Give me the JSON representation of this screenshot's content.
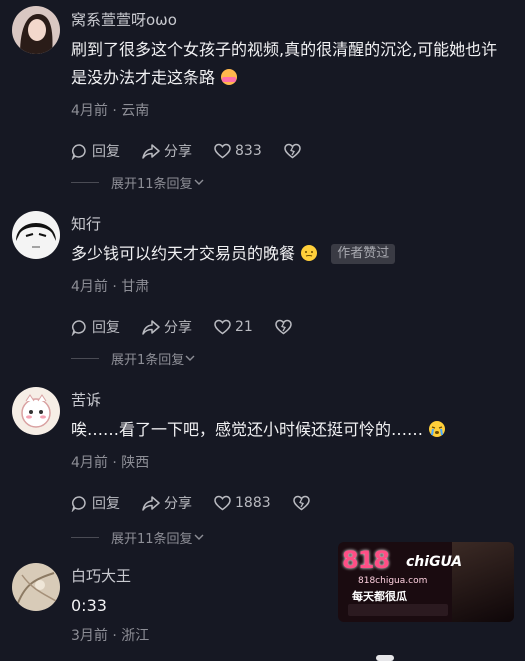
{
  "comments": [
    {
      "username": "窝系萱萱呀oωo",
      "text": "刷到了很多这个女孩子的视频,真的很清醒的沉沦,可能她也许是没办法才走这条路",
      "time": "4月前",
      "location": "云南",
      "reply_label": "回复",
      "share_label": "分享",
      "likes": "833",
      "expand_text": "展开11条回复"
    },
    {
      "username": "知行",
      "text": "多少钱可以约天才交易员的晚餐",
      "badge": "作者赞过",
      "time": "4月前",
      "location": "甘肃",
      "reply_label": "回复",
      "share_label": "分享",
      "likes": "21",
      "expand_text": "展开1条回复"
    },
    {
      "username": "苦诉",
      "text": "唉……看了一下吧，感觉还小时候还挺可怜的……",
      "time": "4月前",
      "location": "陕西",
      "reply_label": "回复",
      "share_label": "分享",
      "likes": "1883",
      "expand_text": "展开11条回复"
    },
    {
      "username": "白巧大王",
      "text": "0:33",
      "time": "3月前",
      "location": "浙江"
    }
  ],
  "ad": {
    "logo": "818",
    "logo_sub": "chiGUA",
    "url": "818chigua.com",
    "slogan": "每天都很瓜"
  },
  "colors": {
    "background": "#161823",
    "text": "#f1f1f3",
    "muted": "#8d8e96",
    "badge_bg": "#3a3b44"
  },
  "icons": [
    "comment-icon",
    "share-icon",
    "heart-icon",
    "dislike-icon",
    "chevron-down-icon"
  ]
}
